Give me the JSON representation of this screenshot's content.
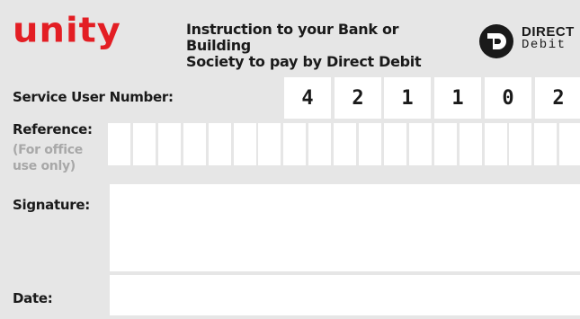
{
  "brand": {
    "logo_text": "unity",
    "logo_color": "#e31e24"
  },
  "header": {
    "instruction_line1": "Instruction to your Bank or Building",
    "instruction_line2": "Society to pay by Direct Debit",
    "direct_debit_line1": "DIRECT",
    "direct_debit_line2": "Debit"
  },
  "form": {
    "service_user_number_label": "Service User Number:",
    "service_user_number_digits": [
      "4",
      "2",
      "1",
      "1",
      "0",
      "2"
    ],
    "reference_label": "Reference:",
    "reference_note_line1": "(For office",
    "reference_note_line2": "use only)",
    "reference_box_count": 19,
    "signature_label": "Signature:",
    "date_label": "Date:"
  }
}
